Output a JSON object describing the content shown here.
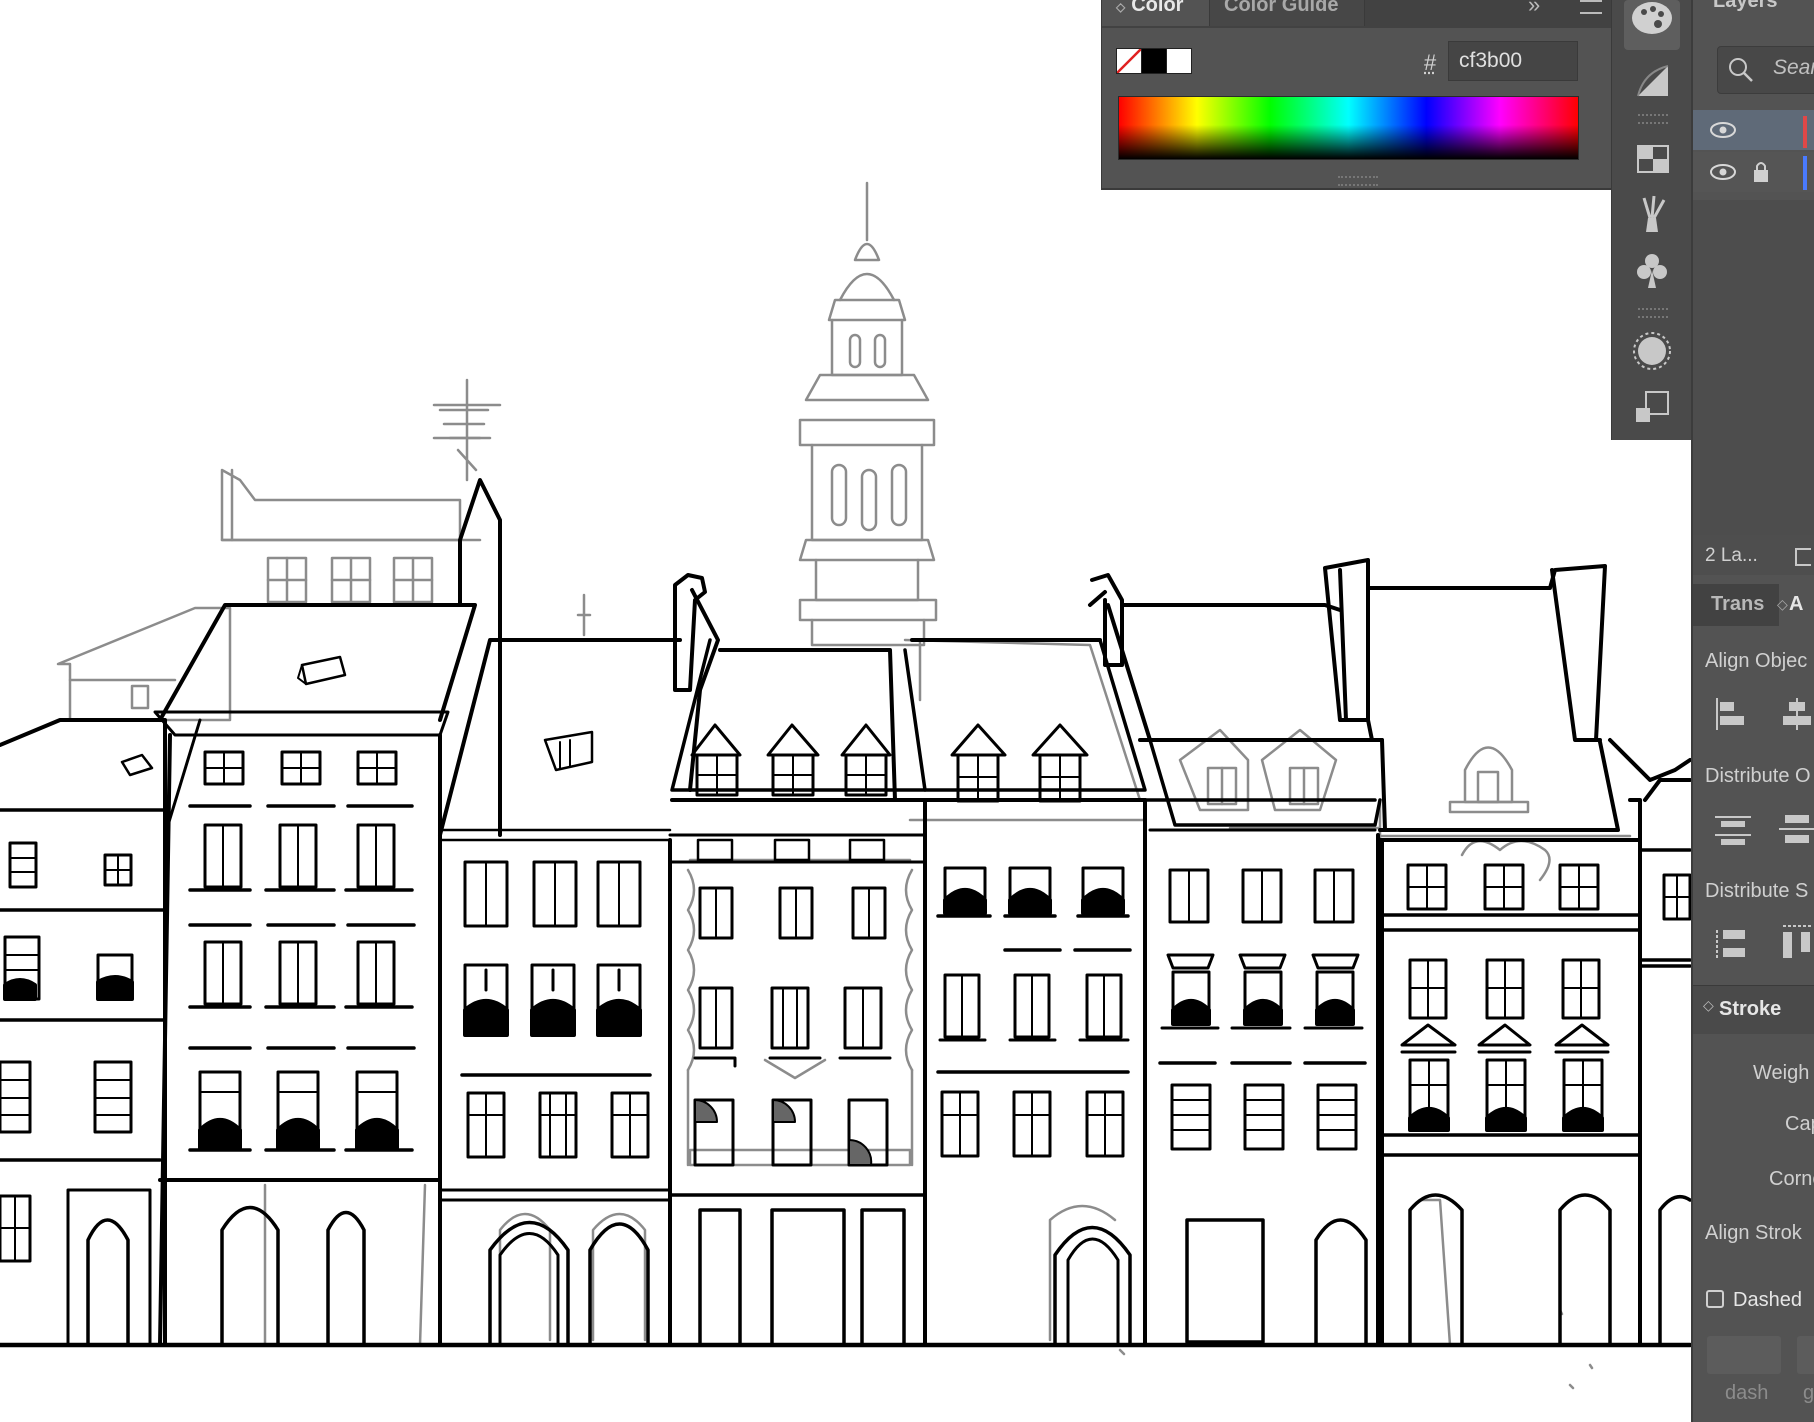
{
  "color_panel": {
    "tabs": [
      "Color",
      "Color Guide"
    ],
    "hex_symbol": "#",
    "hex_value": "cf3b00",
    "swatches": [
      "none",
      "black",
      "white"
    ]
  },
  "icon_dock": {
    "icons": [
      "color-palette-icon",
      "gradient-icon",
      "swatch-grid-icon",
      "brushes-icon",
      "symbols-icon",
      "appearance-icon",
      "transform-icon"
    ]
  },
  "layers_panel": {
    "tab": "Layers",
    "search_placeholder": "Sear",
    "layer_count_label": "2 La...",
    "layer_colors": [
      "#e04848",
      "#4a7bff"
    ]
  },
  "align_panel": {
    "tabs": [
      "Trans",
      "A"
    ],
    "align_objects_label": "Align Objec",
    "distribute_objects_label": "Distribute O",
    "distribute_spacing_label": "Distribute S"
  },
  "stroke_panel": {
    "title": "Stroke",
    "weight_label": "Weigh",
    "cap_label": "Cap",
    "corner_label": "Corne",
    "align_stroke_label": "Align Strok",
    "dashed_label": "Dashed",
    "dashed_checked": false,
    "dash_label": "dash",
    "gap_label": "g"
  },
  "colors": {
    "panel_bg": "#535353",
    "canvas_bg": "#ffffff",
    "ink": "#000000",
    "sketch": "#8a8a8a",
    "accent_selection": "#5f6a78"
  }
}
